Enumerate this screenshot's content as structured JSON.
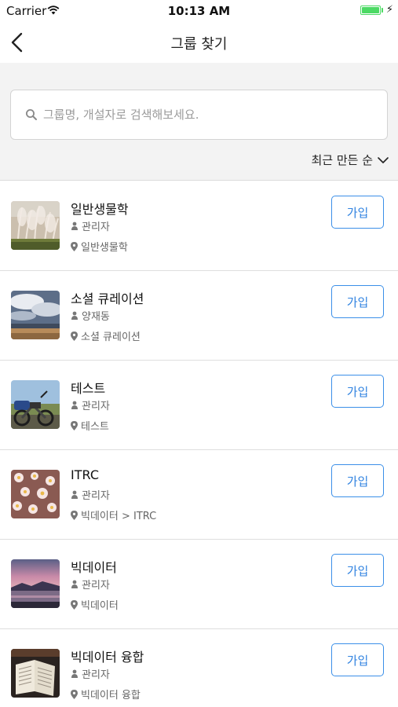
{
  "status_bar": {
    "carrier": "Carrier",
    "time": "10:13 AM",
    "battery_level": 1.0
  },
  "nav": {
    "title": "그룹 찾기",
    "back_icon": "chevron-left-icon"
  },
  "search": {
    "placeholder": "그룹명, 개설자로 검색해보세요.",
    "value": ""
  },
  "sort": {
    "label": "최근 만든 순",
    "icon": "chevron-down-icon"
  },
  "groups": [
    {
      "name": "일반생물학",
      "owner": "관리자",
      "location": "일반생물학",
      "join_label": "가입",
      "image": "pampas-grass"
    },
    {
      "name": "소셜 큐레이션",
      "owner": "양재동",
      "location": "소셜 큐레이션",
      "join_label": "가입",
      "image": "cloudy-sky"
    },
    {
      "name": "테스트",
      "owner": "관리자",
      "location": "테스트",
      "join_label": "가입",
      "image": "motorcycle"
    },
    {
      "name": "ITRC",
      "owner": "관리자",
      "location": "빅데이터 > ITRC",
      "join_label": "가입",
      "image": "flowers"
    },
    {
      "name": "빅데이터",
      "owner": "관리자",
      "location": "빅데이터",
      "join_label": "가입",
      "image": "sunset-lake"
    },
    {
      "name": "빅데이터 융합",
      "owner": "관리자",
      "location": "빅데이터 융합",
      "join_label": "가입",
      "image": "open-book"
    }
  ],
  "colors": {
    "accent": "#2f82e0",
    "battery": "#4cd964",
    "section_bg": "#f3f3f3"
  }
}
